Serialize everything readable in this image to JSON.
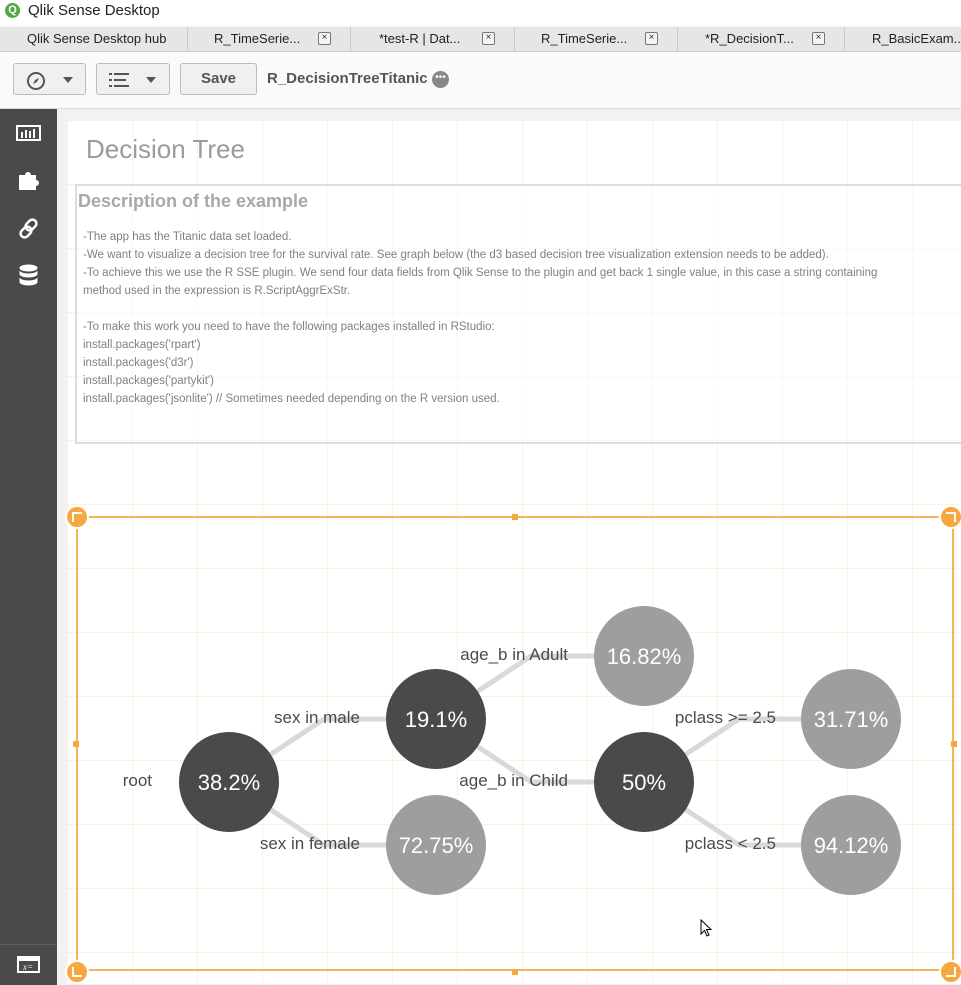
{
  "window": {
    "title": "Qlik Sense Desktop",
    "logo_letter": "Q"
  },
  "tabs": [
    {
      "label": "Qlik Sense Desktop hub",
      "closable": false
    },
    {
      "label": "R_TimeSerie...",
      "closable": true
    },
    {
      "label": "*test-R | Dat...",
      "closable": true
    },
    {
      "label": "R_TimeSerie...",
      "closable": true
    },
    {
      "label": "*R_DecisionT...",
      "closable": true
    },
    {
      "label": "R_BasicExam...",
      "closable": false
    }
  ],
  "toolbar": {
    "navigation_icon": "compass-icon",
    "sheet_menu_icon": "list-icon",
    "save_label": "Save",
    "app_name": "R_DecisionTreeTitanic",
    "more_icon": "more-icon"
  },
  "sidebar": {
    "items": [
      {
        "icon": "charts-icon"
      },
      {
        "icon": "extensions-icon"
      },
      {
        "icon": "link-icon"
      },
      {
        "icon": "database-icon"
      }
    ],
    "bottom_icon": "variables-icon"
  },
  "sheet": {
    "title": "Decision Tree",
    "description": {
      "heading": "Description of the example",
      "lines": [
        "-The app has the Titanic data set loaded.",
        "-We want to visualize a decision tree for the survival rate. See graph below (the d3 based decision tree visualization extension needs to be added).",
        "-To achieve this we use the R SSE plugin. We send four data fields from Qlik Sense to the plugin and get back 1 single value, in this case a string containing",
        "method used in the expression is R.ScriptAggrExStr.",
        "",
        "-To make this work you need to have the following packages installed in RStudio:",
        "install.packages('rpart')",
        "install.packages('d3r')",
        "install.packages('partykit')",
        "install.packages('jsonlite') // Sometimes needed depending on the R version used."
      ]
    }
  },
  "tree": {
    "colors": {
      "internal": "#4a4a4a",
      "leaf": "#9e9e9e",
      "edge": "#d9d9d9",
      "frame": "#f5b55c"
    },
    "nodes": [
      {
        "id": "root",
        "value": "38.2%",
        "type": "internal",
        "incoming_label": "root"
      },
      {
        "id": "male",
        "value": "19.1%",
        "type": "internal",
        "incoming_label": "sex in male",
        "parent": "root"
      },
      {
        "id": "female",
        "value": "72.75%",
        "type": "leaf",
        "incoming_label": "sex in female",
        "parent": "root"
      },
      {
        "id": "adult",
        "value": "16.82%",
        "type": "leaf",
        "incoming_label": "age_b in Adult",
        "parent": "male"
      },
      {
        "id": "child",
        "value": "50%",
        "type": "internal",
        "incoming_label": "age_b in Child",
        "parent": "male"
      },
      {
        "id": "pclass_hi",
        "value": "31.71%",
        "type": "leaf",
        "incoming_label": "pclass >= 2.5",
        "parent": "child"
      },
      {
        "id": "pclass_lo",
        "value": "94.12%",
        "type": "leaf",
        "incoming_label": "pclass < 2.5",
        "parent": "child"
      }
    ]
  }
}
